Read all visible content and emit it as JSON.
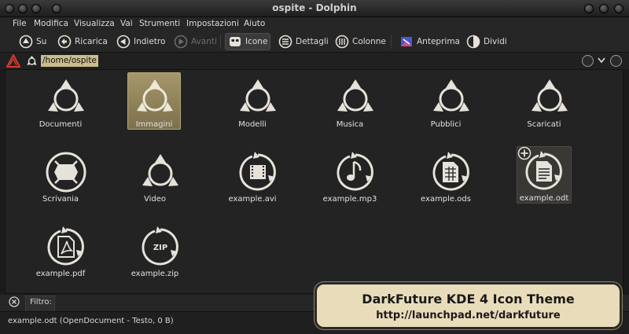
{
  "window": {
    "title": "ospite - Dolphin"
  },
  "menu": [
    "File",
    "Modifica",
    "Visualizza",
    "Vai",
    "Strumenti",
    "Impostazioni",
    "Aiuto"
  ],
  "toolbar": {
    "up": "Su",
    "reload": "Ricarica",
    "back": "Indietro",
    "forward": "Avanti",
    "icons": "Icone",
    "details": "Dettagli",
    "columns": "Colonne",
    "preview": "Anteprima",
    "split": "Dividi"
  },
  "location": {
    "path": "/home/ospite"
  },
  "files": [
    {
      "name": "Documenti",
      "icon": "folder-icon"
    },
    {
      "name": "Immagini",
      "icon": "folder-icon",
      "selected": true
    },
    {
      "name": "Modelli",
      "icon": "folder-icon"
    },
    {
      "name": "Musica",
      "icon": "folder-icon"
    },
    {
      "name": "Pubblici",
      "icon": "folder-icon"
    },
    {
      "name": "Scaricati",
      "icon": "folder-icon"
    },
    {
      "name": "Scrivania",
      "icon": "desktop-icon"
    },
    {
      "name": "Video",
      "icon": "folder-icon"
    },
    {
      "name": "example.avi",
      "icon": "video-file-icon"
    },
    {
      "name": "example.mp3",
      "icon": "audio-file-icon"
    },
    {
      "name": "example.ods",
      "icon": "spreadsheet-file-icon"
    },
    {
      "name": "example.odt",
      "icon": "text-document-icon",
      "hovered": true
    },
    {
      "name": "example.pdf",
      "icon": "pdf-file-icon"
    },
    {
      "name": "example.zip",
      "icon": "zip-file-icon"
    }
  ],
  "filter": {
    "label": "Filtro:"
  },
  "status": {
    "text": "example.odt (OpenDocument - Testo, 0 B)"
  },
  "banner": {
    "title": "DarkFuture KDE 4 Icon Theme",
    "url": "http://launchpad.net/darkfuture"
  },
  "colors": {
    "selection": "#a5976a",
    "path_highlight": "#cbbd8c",
    "banner_bg": "#e9dcba",
    "icon_stroke": "#e6e2da"
  }
}
